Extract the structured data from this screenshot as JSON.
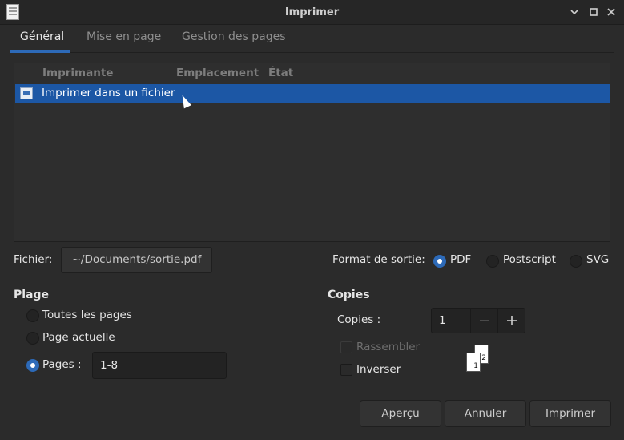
{
  "window": {
    "title": "Imprimer"
  },
  "tabs": [
    {
      "label": "Général",
      "active": true
    },
    {
      "label": "Mise en page",
      "active": false
    },
    {
      "label": "Gestion des pages",
      "active": false
    }
  ],
  "printer_list": {
    "columns": [
      "Imprimante",
      "Emplacement",
      "État"
    ],
    "rows": [
      {
        "name": "Imprimer dans un fichier",
        "location": "",
        "state": "",
        "selected": true
      }
    ]
  },
  "file": {
    "label": "Fichier:",
    "value": "~/Documents/sortie.pdf"
  },
  "output_format": {
    "label": "Format de sortie:",
    "options": [
      {
        "label": "PDF",
        "selected": true
      },
      {
        "label": "Postscript",
        "selected": false
      },
      {
        "label": "SVG",
        "selected": false
      }
    ]
  },
  "range": {
    "heading": "Plage",
    "all_pages": "Toutes les pages",
    "current_page": "Page actuelle",
    "pages_label": "Pages :",
    "pages_value": "1-8",
    "selected": "pages"
  },
  "copies": {
    "heading": "Copies",
    "label": "Copies :",
    "value": "1",
    "collate_label": "Rassembler",
    "collate_checked": false,
    "collate_enabled": false,
    "reverse_label": "Inverser",
    "reverse_checked": false,
    "preview_pages": [
      "1",
      "2"
    ]
  },
  "buttons": {
    "preview": "Aperçu",
    "cancel": "Annuler",
    "print": "Imprimer"
  },
  "colors": {
    "accent": "#2d6ab8",
    "selection": "#1c57a5",
    "background": "#2b2b2b"
  },
  "icons": {
    "app": "document-icon",
    "minimize": "minimize-icon",
    "maximize": "maximize-icon",
    "close": "close-icon",
    "printer_row": "print-to-file-icon",
    "spin_minus": "minus-icon",
    "spin_plus": "plus-icon"
  }
}
